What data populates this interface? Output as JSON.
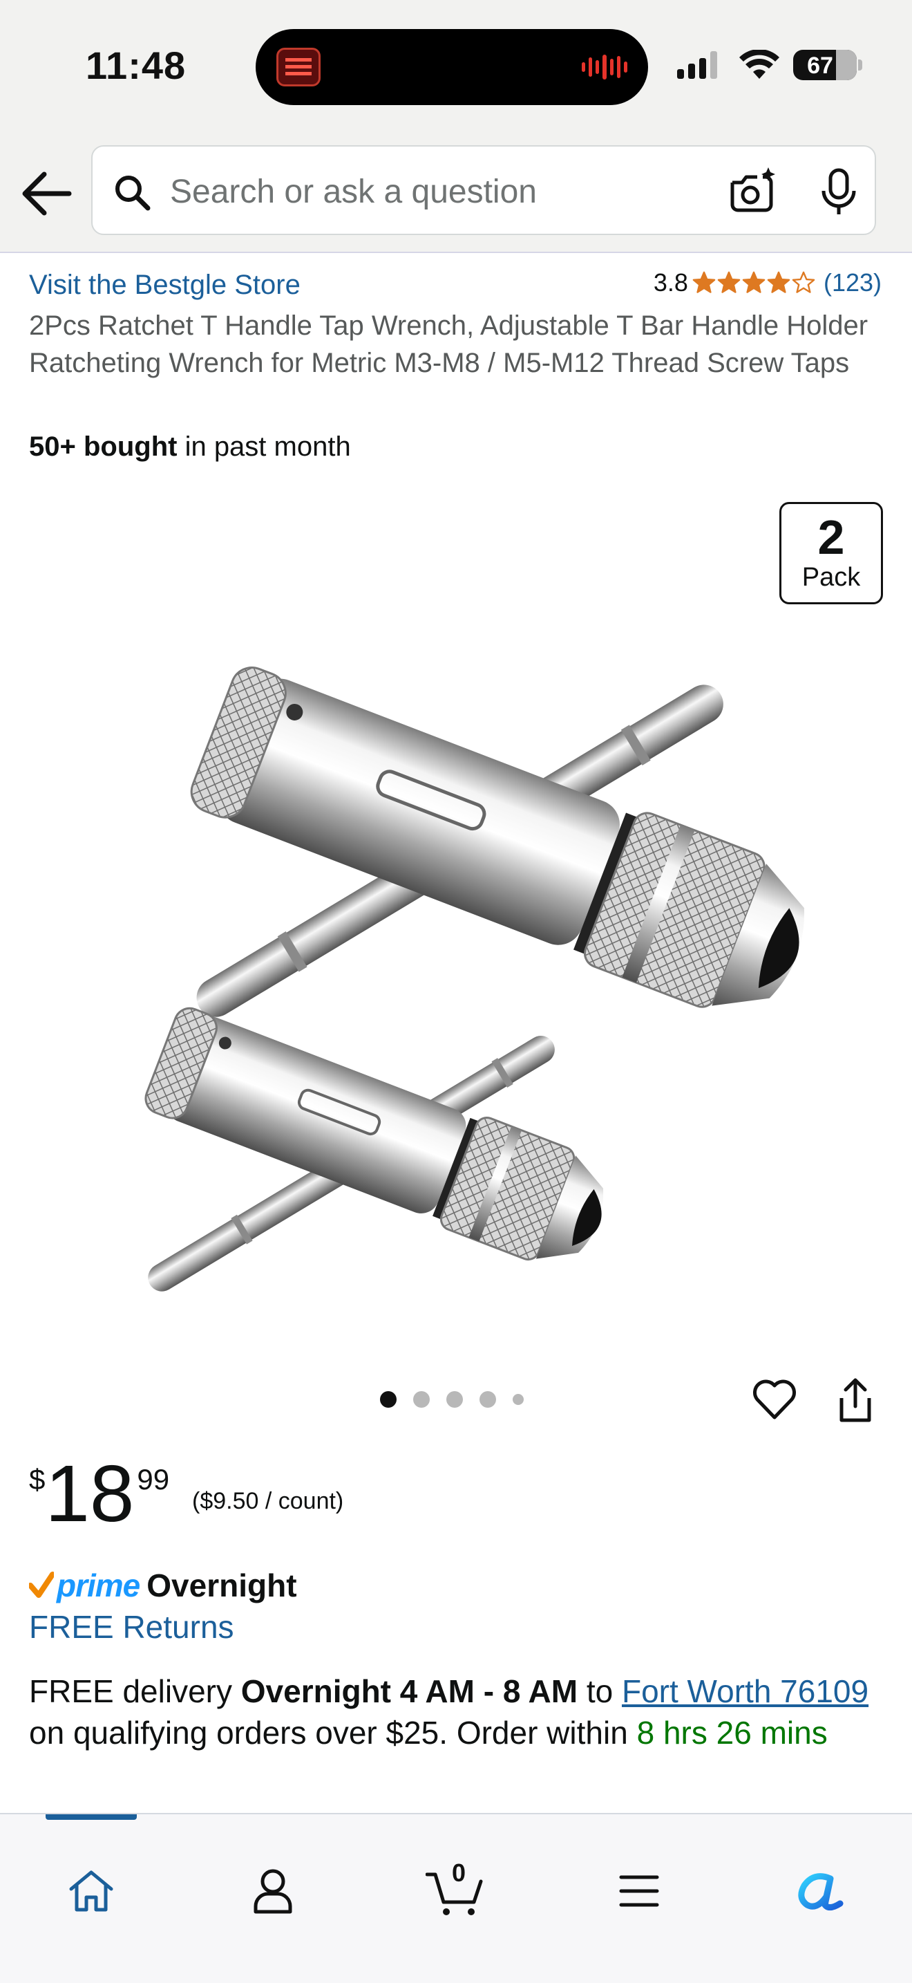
{
  "status_bar": {
    "time": "11:48",
    "battery": "67",
    "battery_level": 0.67
  },
  "search": {
    "placeholder": "Search or ask a question"
  },
  "product": {
    "store_link": "Visit the Bestgle Store",
    "rating": "3.8",
    "rating_value": 3.8,
    "rating_count": "(123)",
    "title": "2Pcs Ratchet T Handle Tap Wrench, Adjustable T Bar Handle Holder Ratcheting Wrench for Metric M3-M8 / M5-M12 Thread Screw Taps",
    "bought_bold": "50+ bought",
    "bought_rest": " in past month",
    "badge_number": "2",
    "badge_label": "Pack",
    "image_count": 5,
    "image_active": 1
  },
  "price": {
    "symbol": "$",
    "whole": "18",
    "fraction": "99",
    "unit": "($9.50 / count)"
  },
  "delivery": {
    "prime_label": "prime",
    "prime_speed": "Overnight",
    "free_returns": "FREE Returns",
    "text_1": "FREE delivery ",
    "window": "Overnight 4 AM - 8 AM",
    "text_2": " to ",
    "location": "Fort Worth 76109",
    "text_3": " on qualifying orders over $25. Order within ",
    "countdown": "8 hrs 26 mins"
  },
  "nav": {
    "cart_count": "0",
    "items": [
      "home-icon",
      "account-icon",
      "cart-icon",
      "menu-icon",
      "rufus-icon"
    ]
  },
  "colors": {
    "link": "#1b5f9a",
    "prime": "#1a98ff",
    "star": "#de7921",
    "green": "#007600"
  }
}
